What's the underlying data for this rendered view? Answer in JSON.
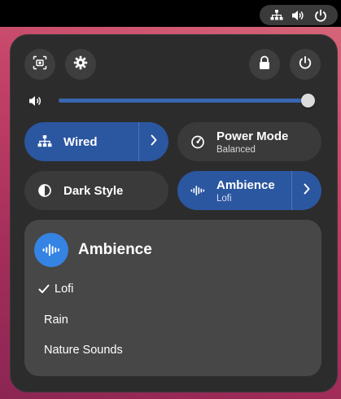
{
  "topbar": {
    "tray_icons": [
      "network-wired-icon",
      "volume-icon",
      "power-icon"
    ]
  },
  "panel": {
    "header_buttons": {
      "screenshot": "screenshot-icon",
      "settings": "gear-icon",
      "lock": "lock-icon",
      "power": "power-icon"
    },
    "volume": {
      "icon": "volume-icon",
      "level": 1.0
    },
    "tiles": {
      "wired": {
        "title": "Wired",
        "icon": "network-wired-icon",
        "active": true,
        "has_arrow": true
      },
      "power_mode": {
        "title": "Power Mode",
        "subtitle": "Balanced",
        "icon": "gauge-icon",
        "active": false
      },
      "dark_style": {
        "title": "Dark Style",
        "icon": "dark-style-icon",
        "active": false
      },
      "ambience": {
        "title": "Ambience",
        "subtitle": "Lofi",
        "icon": "waveform-icon",
        "active": true,
        "has_arrow": true
      }
    },
    "menu": {
      "title": "Ambience",
      "icon": "waveform-icon",
      "items": [
        {
          "label": "Lofi",
          "selected": true
        },
        {
          "label": "Rain",
          "selected": false
        },
        {
          "label": "Nature Sounds",
          "selected": false
        }
      ]
    }
  },
  "colors": {
    "accent": "#3584e4",
    "active_tile": "#2b56a0",
    "panel_bg": "#2c2c2c",
    "tile_bg": "#3a3a3a",
    "menu_bg": "#474747"
  }
}
